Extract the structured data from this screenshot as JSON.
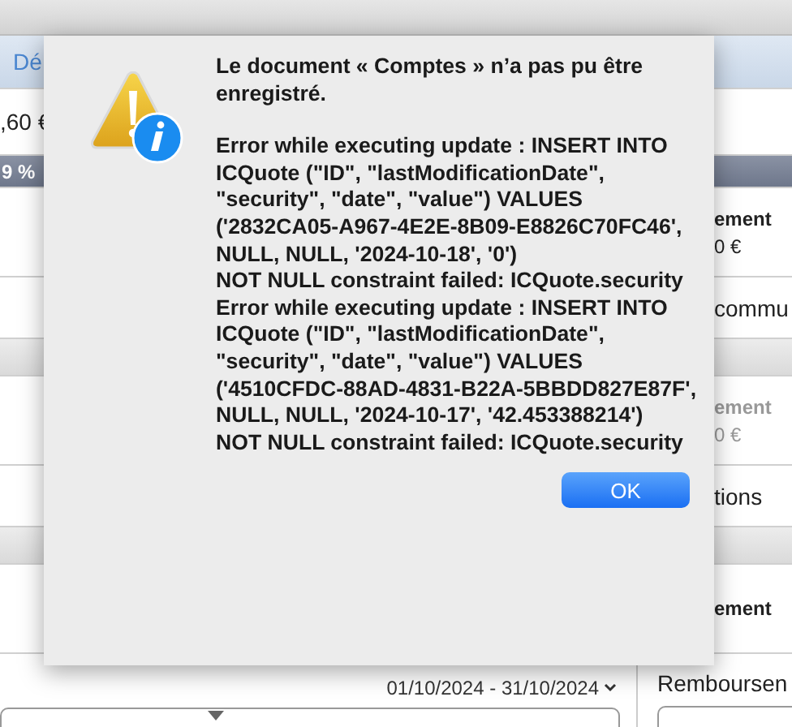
{
  "background": {
    "tab_fragment": "Dé",
    "amount_fragment": ",60 €",
    "header_fragment": "9 %",
    "right_rows": [
      {
        "kind": "total",
        "label": "ement",
        "value": "0 €",
        "disabled": false
      },
      {
        "kind": "text",
        "label": "commu"
      },
      {
        "kind": "band"
      },
      {
        "kind": "total",
        "label": "ement",
        "value": "0 €",
        "disabled": true
      },
      {
        "kind": "text",
        "label": "tions"
      },
      {
        "kind": "band"
      },
      {
        "kind": "total",
        "label": "ement",
        "disabled": false
      }
    ],
    "date_range": "01/10/2024 - 31/10/2024",
    "side_label": "Remboursen"
  },
  "dialog": {
    "title": "Le document « Comptes » n’a pas pu être enregistré.",
    "messages": [
      "Error while executing update : INSERT INTO ICQuote (\"ID\", \"lastModificationDate\", \"security\", \"date\", \"value\") VALUES ('2832CA05-A967-4E2E-8B09-E8826C70FC46', NULL, NULL, '2024-10-18', '0')",
      "NOT NULL constraint failed: ICQuote.security",
      "Error while executing update : INSERT INTO ICQuote (\"ID\", \"lastModificationDate\", \"security\", \"date\", \"value\") VALUES ('4510CFDC-88AD-4831-B22A-5BBDD827E87F', NULL, NULL, '2024-10-17', '42.453388214')",
      "NOT NULL constraint failed: ICQuote.security"
    ],
    "button": "OK"
  }
}
